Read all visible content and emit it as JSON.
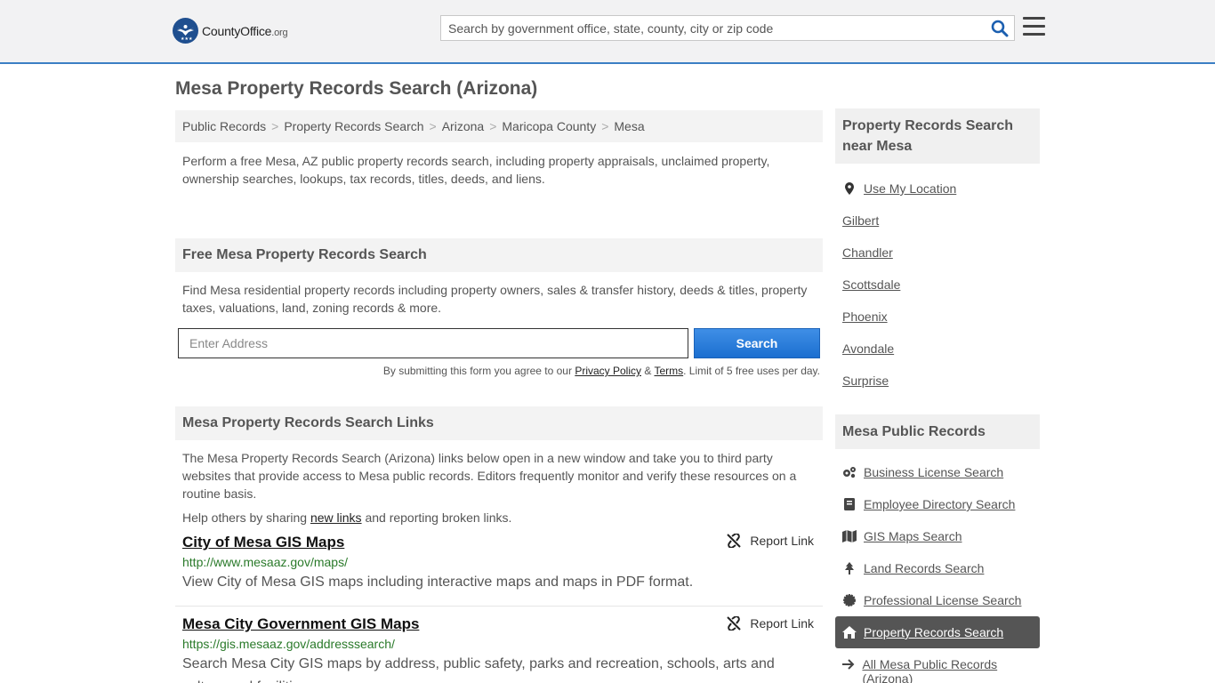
{
  "header": {
    "logo_main": "CountyOffice",
    "logo_tld": ".org",
    "search_placeholder": "Search by government office, state, county, city or zip code"
  },
  "page_title": "Mesa Property Records Search (Arizona)",
  "breadcrumb": [
    "Public Records",
    "Property Records Search",
    "Arizona",
    "Maricopa County",
    "Mesa"
  ],
  "intro": "Perform a free Mesa, AZ public property records search, including property appraisals, unclaimed property, ownership searches, lookups, tax records, titles, deeds, and liens.",
  "free_search": {
    "heading": "Free Mesa Property Records Search",
    "desc": "Find Mesa residential property records including property owners, sales & transfer history, deeds & titles, property taxes, valuations, land, zoning records & more.",
    "address_placeholder": "Enter Address",
    "button": "Search",
    "agree_prefix": "By submitting this form you agree to our ",
    "privacy": "Privacy Policy",
    "amp": " & ",
    "terms": "Terms",
    "agree_suffix": ". Limit of 5 free uses per day."
  },
  "links_section": {
    "heading": "Mesa Property Records Search Links",
    "desc": "The Mesa Property Records Search (Arizona) links below open in a new window and take you to third party websites that provide access to Mesa public records. Editors frequently monitor and verify these resources on a routine basis.",
    "share_prefix": "Help others by sharing ",
    "share_link": "new links",
    "share_suffix": " and reporting broken links.",
    "report_label": "Report Link",
    "items": [
      {
        "title": "City of Mesa GIS Maps",
        "url": "http://www.mesaaz.gov/maps/",
        "desc": "View City of Mesa GIS maps including interactive maps and maps in PDF format."
      },
      {
        "title": "Mesa City Government GIS Maps",
        "url": "https://gis.mesaaz.gov/addresssearch/",
        "desc": "Search Mesa City GIS maps by address, public safety, parks and recreation, schools, arts and culture and facilities."
      }
    ]
  },
  "sidebar": {
    "near_heading": "Property Records Search near Mesa",
    "use_location": "Use My Location",
    "near": [
      "Gilbert",
      "Chandler",
      "Scottsdale",
      "Phoenix",
      "Avondale",
      "Surprise"
    ],
    "public_heading": "Mesa Public Records",
    "public": [
      {
        "label": "Business License Search",
        "icon": "gears-icon"
      },
      {
        "label": "Employee Directory Search",
        "icon": "book-icon"
      },
      {
        "label": "GIS Maps Search",
        "icon": "map-icon"
      },
      {
        "label": "Land Records Search",
        "icon": "tree-icon"
      },
      {
        "label": "Professional License Search",
        "icon": "certificate-icon"
      },
      {
        "label": "Property Records Search",
        "icon": "home-icon"
      },
      {
        "label": "All Mesa Public Records (Arizona)",
        "icon": "arrow-right-icon"
      }
    ],
    "active_index": 5
  }
}
